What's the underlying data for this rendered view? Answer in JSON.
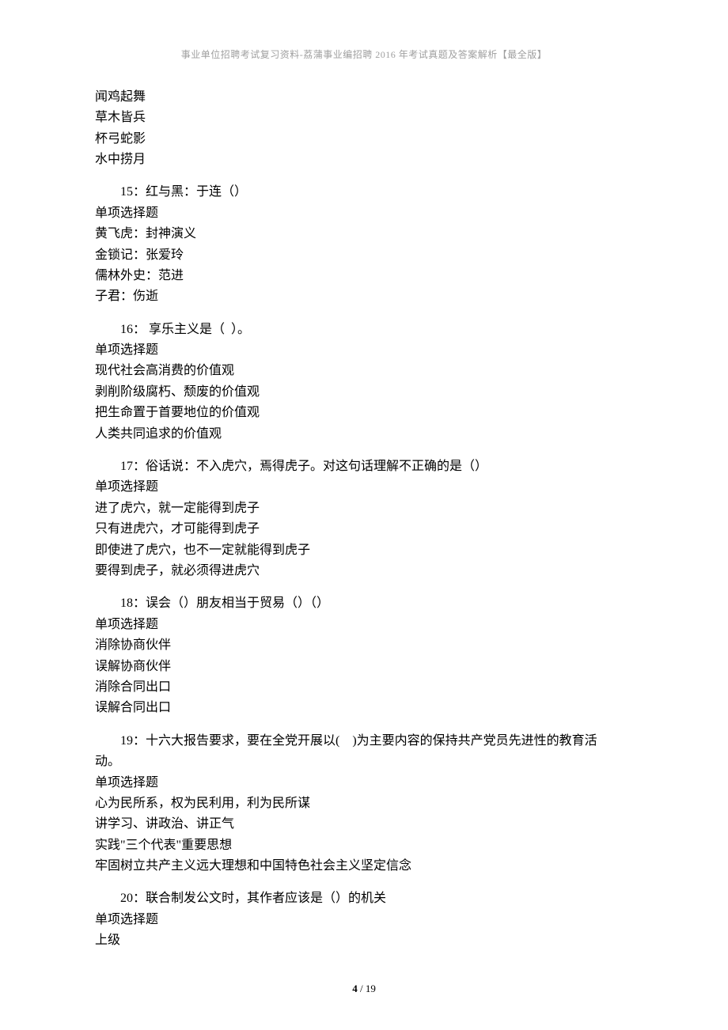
{
  "header": "事业单位招聘考试复习资料-荔蒲事业编招聘 2016 年考试真题及答案解析【最全版】",
  "pre_lines": [
    "闻鸡起舞",
    "草木皆兵",
    "杯弓蛇影",
    "水中捞月"
  ],
  "questions": [
    {
      "number": "15",
      "stem": "红与黑：于连（）",
      "type": "单项选择题",
      "options": [
        "黄飞虎：封神演义",
        "金锁记：张爱玲",
        "儒林外史：范进",
        "子君：伤逝"
      ]
    },
    {
      "number": "16",
      "stem": " 享乐主义是（  ）。",
      "type": "单项选择题",
      "options": [
        "现代社会高消费的价值观",
        "剥削阶级腐朽、颓废的价值观",
        "把生命置于首要地位的价值观",
        "人类共同追求的价值观"
      ]
    },
    {
      "number": "17",
      "stem": "俗话说：不入虎穴，焉得虎子。对这句话理解不正确的是（）",
      "type": "单项选择题",
      "options": [
        "进了虎穴，就一定能得到虎子",
        "只有进虎穴，才可能得到虎子",
        "即使进了虎穴，也不一定就能得到虎子",
        "要得到虎子，就必须得进虎穴"
      ]
    },
    {
      "number": "18",
      "stem": "误会（）朋友相当于贸易（）（）",
      "type": "单项选择题",
      "options": [
        "消除协商伙伴",
        "误解协商伙伴",
        "消除合同出口",
        "误解合同出口"
      ]
    },
    {
      "number": "19",
      "stem": "十六大报告要求，要在全党开展以(　)为主要内容的保持共产党员先进性的教育活",
      "stem_cont": "动。",
      "type": "单项选择题",
      "options": [
        "心为民所系，权为民利用，利为民所谋",
        "讲学习、讲政治、讲正气",
        "实践\"三个代表\"重要思想",
        "牢固树立共产主义远大理想和中国特色社会主义坚定信念"
      ]
    },
    {
      "number": "20",
      "stem": "联合制发公文时，其作者应该是（）的机关",
      "type": "单项选择题",
      "options": [
        "上级"
      ]
    }
  ],
  "footer": {
    "page": "4",
    "sep": " / ",
    "total": "19"
  }
}
